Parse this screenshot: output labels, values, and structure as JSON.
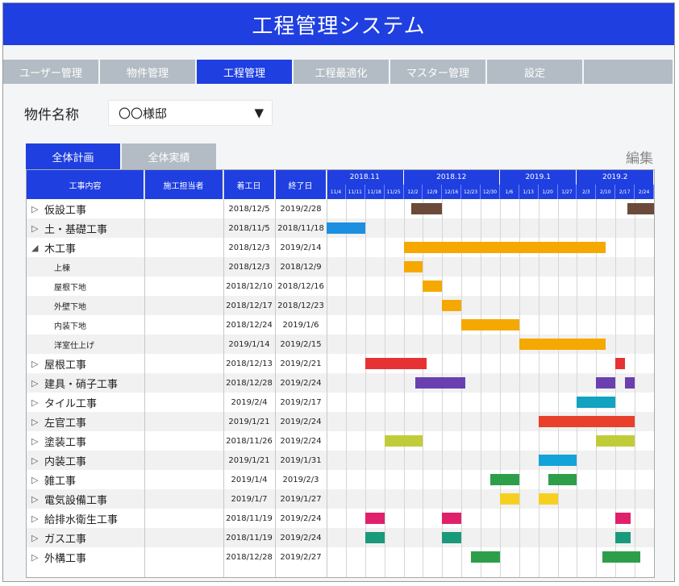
{
  "app": {
    "title": "工程管理システム"
  },
  "nav": {
    "tabs": [
      "ユーザー管理",
      "物件管理",
      "工程管理",
      "工程最適化",
      "マスター管理",
      "設定",
      ""
    ],
    "active": 2
  },
  "property": {
    "label": "物件名称",
    "value": "〇〇様邸",
    "arrow": "▼"
  },
  "subtabs": {
    "items": [
      "全体計画",
      "全体実績"
    ],
    "active": 0
  },
  "edit_link": "編集",
  "table": {
    "headers": [
      "工事内容",
      "施工担当者",
      "着工日",
      "終了日"
    ],
    "months": [
      "2018.11",
      "2018.12",
      "2019.1",
      "2019.2"
    ],
    "weeks": [
      "11/4",
      "11/11",
      "11/18",
      "11/25",
      "12/2",
      "12/9",
      "12/16",
      "12/23",
      "12/30",
      "1/6",
      "1/13",
      "1/20",
      "1/27",
      "2/3",
      "2/10",
      "2/17",
      "2/24"
    ],
    "rows": [
      {
        "name": "仮設工事",
        "expand": "▷",
        "sub": false,
        "start": "2018/12/5",
        "end": "2019/2/28"
      },
      {
        "name": "土・基礎工事",
        "expand": "▷",
        "sub": false,
        "start": "2018/11/5",
        "end": "2018/11/18"
      },
      {
        "name": "木工事",
        "expand": "◢",
        "sub": false,
        "start": "2018/12/3",
        "end": "2019/2/14"
      },
      {
        "name": "上棟",
        "expand": "",
        "sub": true,
        "start": "2018/12/3",
        "end": "2018/12/9"
      },
      {
        "name": "屋根下地",
        "expand": "",
        "sub": true,
        "start": "2018/12/10",
        "end": "2018/12/16"
      },
      {
        "name": "外壁下地",
        "expand": "",
        "sub": true,
        "start": "2018/12/17",
        "end": "2018/12/23"
      },
      {
        "name": "内装下地",
        "expand": "",
        "sub": true,
        "start": "2018/12/24",
        "end": "2019/1/6"
      },
      {
        "name": "洋室仕上げ",
        "expand": "",
        "sub": true,
        "start": "2019/1/14",
        "end": "2019/2/15"
      },
      {
        "name": "屋根工事",
        "expand": "▷",
        "sub": false,
        "start": "2018/12/13",
        "end": "2019/2/21"
      },
      {
        "name": "建具・硝子工事",
        "expand": "▷",
        "sub": false,
        "start": "2018/12/28",
        "end": "2019/2/24"
      },
      {
        "name": "タイル工事",
        "expand": "▷",
        "sub": false,
        "start": "2019/2/4",
        "end": "2019/2/17"
      },
      {
        "name": "左官工事",
        "expand": "▷",
        "sub": false,
        "start": "2019/1/21",
        "end": "2019/2/24"
      },
      {
        "name": "塗装工事",
        "expand": "▷",
        "sub": false,
        "start": "2018/11/26",
        "end": "2019/2/24"
      },
      {
        "name": "内装工事",
        "expand": "▷",
        "sub": false,
        "start": "2019/1/21",
        "end": "2019/1/31"
      },
      {
        "name": "雑工事",
        "expand": "▷",
        "sub": false,
        "start": "2019/1/4",
        "end": "2019/2/3"
      },
      {
        "name": "電気設備工事",
        "expand": "▷",
        "sub": false,
        "start": "2019/1/7",
        "end": "2019/1/27"
      },
      {
        "name": "給排水衛生工事",
        "expand": "▷",
        "sub": false,
        "start": "2018/11/19",
        "end": "2019/2/24"
      },
      {
        "name": "ガス工事",
        "expand": "▷",
        "sub": false,
        "start": "2018/11/19",
        "end": "2019/2/24"
      },
      {
        "name": "外構工事",
        "expand": "▷",
        "sub": false,
        "start": "2018/12/28",
        "end": "2019/2/27"
      }
    ]
  },
  "bars": [
    {
      "row": 0,
      "start": 4.4,
      "end": 6.0,
      "color": "#6b4a3a"
    },
    {
      "row": 0,
      "start": 15.6,
      "end": 17.0,
      "color": "#6b4a3a"
    },
    {
      "row": 1,
      "start": 0.0,
      "end": 2.0,
      "color": "#1d8fe0"
    },
    {
      "row": 2,
      "start": 4.0,
      "end": 14.5,
      "color": "#f5a800"
    },
    {
      "row": 3,
      "start": 4.0,
      "end": 5.0,
      "color": "#f5a800"
    },
    {
      "row": 4,
      "start": 5.0,
      "end": 6.0,
      "color": "#f5a800"
    },
    {
      "row": 5,
      "start": 6.0,
      "end": 7.0,
      "color": "#f5a800"
    },
    {
      "row": 6,
      "start": 7.0,
      "end": 10.0,
      "color": "#f5a800"
    },
    {
      "row": 7,
      "start": 10.0,
      "end": 14.5,
      "color": "#f5a800"
    },
    {
      "row": 8,
      "start": 2.0,
      "end": 5.2,
      "color": "#e63232"
    },
    {
      "row": 8,
      "start": 15.0,
      "end": 15.5,
      "color": "#e63232"
    },
    {
      "row": 9,
      "start": 4.6,
      "end": 7.2,
      "color": "#6a3fb0"
    },
    {
      "row": 9,
      "start": 14.0,
      "end": 15.0,
      "color": "#6a3fb0"
    },
    {
      "row": 9,
      "start": 15.5,
      "end": 16.0,
      "color": "#6a3fb0"
    },
    {
      "row": 10,
      "start": 13.0,
      "end": 15.0,
      "color": "#12a3c0"
    },
    {
      "row": 11,
      "start": 11.0,
      "end": 16.0,
      "color": "#e8402a"
    },
    {
      "row": 12,
      "start": 3.0,
      "end": 5.0,
      "color": "#c0cc3a"
    },
    {
      "row": 12,
      "start": 14.0,
      "end": 16.0,
      "color": "#c0cc3a"
    },
    {
      "row": 13,
      "start": 11.0,
      "end": 13.0,
      "color": "#12a3d8"
    },
    {
      "row": 14,
      "start": 8.5,
      "end": 10.0,
      "color": "#2e9e4a"
    },
    {
      "row": 14,
      "start": 11.5,
      "end": 13.0,
      "color": "#2e9e4a"
    },
    {
      "row": 15,
      "start": 9.0,
      "end": 10.0,
      "color": "#f5d020"
    },
    {
      "row": 15,
      "start": 11.0,
      "end": 12.0,
      "color": "#f5d020"
    },
    {
      "row": 16,
      "start": 2.0,
      "end": 3.0,
      "color": "#e0206a"
    },
    {
      "row": 16,
      "start": 6.0,
      "end": 7.0,
      "color": "#e0206a"
    },
    {
      "row": 16,
      "start": 15.0,
      "end": 15.8,
      "color": "#e0206a"
    },
    {
      "row": 17,
      "start": 2.0,
      "end": 3.0,
      "color": "#1a9a7a"
    },
    {
      "row": 17,
      "start": 6.0,
      "end": 7.0,
      "color": "#1a9a7a"
    },
    {
      "row": 17,
      "start": 15.0,
      "end": 15.8,
      "color": "#1a9a7a"
    },
    {
      "row": 18,
      "start": 7.5,
      "end": 9.0,
      "color": "#2e9e4a"
    },
    {
      "row": 18,
      "start": 14.3,
      "end": 16.3,
      "color": "#2e9e4a"
    }
  ]
}
